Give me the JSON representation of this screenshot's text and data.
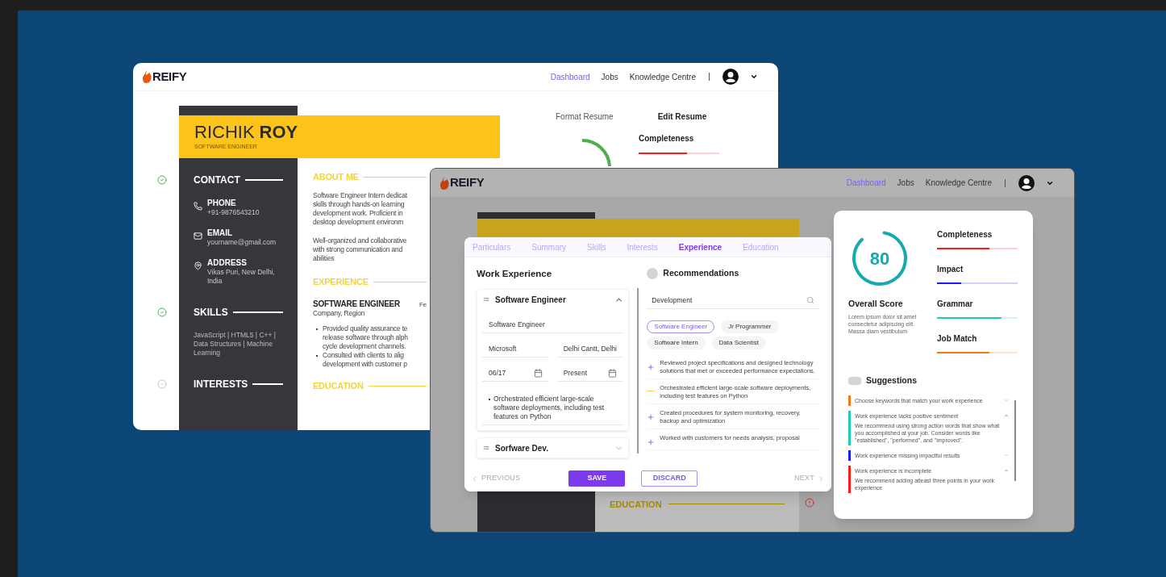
{
  "back_window": {
    "brand": "REIFY",
    "nav": [
      {
        "label": "Dashboard",
        "selected": true
      },
      {
        "label": "Jobs",
        "selected": false
      },
      {
        "label": "Knowledge Centre",
        "selected": false
      }
    ],
    "resume": {
      "name_first": "RICHIK",
      "name_last": "ROY",
      "role": "SOFTWARE ENGINEER",
      "side_sections": [
        {
          "title": "CONTACT",
          "checked": true,
          "items": [
            {
              "kind": "phone",
              "label": "PHONE",
              "value": "+91-9876543210"
            },
            {
              "kind": "email",
              "label": "EMAIL",
              "value": "yourname@gmail.com"
            },
            {
              "kind": "address",
              "label": "ADDRESS",
              "value": "Vikas Puri, New Delhi, India"
            }
          ]
        },
        {
          "title": "SKILLS",
          "checked": true,
          "text": "JavaScript | HTML5 | C++ | Data Structures | Machine Learning"
        },
        {
          "title": "INTERESTS",
          "checked": false
        }
      ],
      "about": {
        "title": "ABOUT ME",
        "paragraphs": [
          [
            "Software Engineer Intern dedicat",
            "skills through hands-on learning",
            "development work. Proficient in",
            "desktop development environm"
          ],
          [
            "Well-organized and collaborative",
            "with strong communication and",
            "abilities"
          ]
        ]
      },
      "experience": {
        "title": "EXPERIENCE",
        "job": "SOFTWARE ENGINEER",
        "date": "Fe",
        "company": "Company, Region",
        "bullets": [
          [
            "Provided quality assurance te",
            "release software through alph",
            "cycle development channels."
          ],
          [
            "Consulted with clients to alig",
            "development with customer p"
          ]
        ]
      },
      "education": {
        "title": "EDUCATION"
      }
    },
    "panel": {
      "tabs": [
        {
          "label": "Format Resume",
          "selected": false
        },
        {
          "label": "Edit Resume",
          "selected": true
        }
      ],
      "metric": {
        "label": "Completeness",
        "level": 0.6,
        "color": "#ff1a1a"
      }
    }
  },
  "front_window": {
    "brand": "REIFY",
    "nav": [
      {
        "label": "Dashboard",
        "selected": true
      },
      {
        "label": "Jobs",
        "selected": false
      },
      {
        "label": "Knowledge Centre",
        "selected": false
      }
    ],
    "backdrop": {
      "education_title": "EDUCATION"
    },
    "editor": {
      "tabs": [
        {
          "label": "Particulars",
          "selected": false
        },
        {
          "label": "Summary",
          "selected": false
        },
        {
          "label": "Skills",
          "selected": false
        },
        {
          "label": "Interests",
          "selected": false
        },
        {
          "label": "Experience",
          "selected": true
        },
        {
          "label": "Education",
          "selected": false
        }
      ],
      "title": "Work Experience",
      "entries": [
        {
          "title": "Software Engineer",
          "expanded": true,
          "fields": [
            [
              {
                "kind": "text",
                "value": "Software Engineer"
              }
            ],
            [
              {
                "kind": "text",
                "value": "Microsoft"
              },
              {
                "kind": "text",
                "value": "Delhi Cantt, Delhi"
              }
            ],
            [
              {
                "kind": "date",
                "value": "06/17"
              },
              {
                "kind": "date",
                "value": "Present"
              }
            ]
          ],
          "bullets": [
            "Orchestrated efficient large-scale software deployments, including test features on Python"
          ]
        },
        {
          "title": "Sorfware Dev.",
          "expanded": false
        }
      ],
      "recommendations": {
        "title": "Recommendations",
        "search_value": "Development",
        "chips": [
          {
            "label": "Software Engineer",
            "selected": true
          },
          {
            "label": "Jr Programmer",
            "selected": false
          },
          {
            "label": "Software Intern",
            "selected": false
          },
          {
            "label": "Data Scientist",
            "selected": false
          }
        ],
        "items": [
          {
            "kind": "add",
            "text": "Reviewed project specifications and designed technology solutions that met or exceeded performance expectations."
          },
          {
            "kind": "added",
            "text": "Orchestrated efficient large-scale software deployments, including test features on Python"
          },
          {
            "kind": "add",
            "text": "Created procedures for system monitoring, recovery, backup and optimization"
          },
          {
            "kind": "add",
            "text": "Worked with customers for needs analysis, proposal"
          }
        ]
      },
      "footer": {
        "previous": "PREVIOUS",
        "save": "SAVE",
        "discard": "DISCARD",
        "next": "NEXT"
      }
    },
    "score": {
      "value": "80",
      "level": 0.85,
      "title": "Overall Score",
      "description": "Lorem ipsum dolor sit amet consectetur adipiscing elit. Massa diam vestibulum",
      "metrics": [
        {
          "label": "Completeness",
          "level": 0.65,
          "color": "#ff1a1a"
        },
        {
          "label": "Impact",
          "level": 0.3,
          "color": "#1a1aff"
        },
        {
          "label": "Grammar",
          "level": 0.8,
          "color": "#1dcfb0"
        },
        {
          "label": "Job Match",
          "level": 0.65,
          "color": "#f07a1a"
        }
      ],
      "suggestions_title": "Suggestions",
      "suggestions": [
        {
          "color": "#f07a1a",
          "title": "Choose keywords that match your work experience",
          "expanded": false
        },
        {
          "color": "#1dcfb0",
          "title": "Work experience lacks positive sentiment",
          "expanded": true,
          "body": "We recommend using strong action words that show what you accomplished at your job. Consider words like \"established\", \"performed\", and \"improved\"."
        },
        {
          "color": "#1a1aff",
          "title": "Work experience missing impactful results",
          "expanded": false
        },
        {
          "color": "#ff1a1a",
          "title": "Work experience is incomplete",
          "expanded": true,
          "body": "We recommend adding atleast three points in your work experience"
        }
      ]
    }
  }
}
